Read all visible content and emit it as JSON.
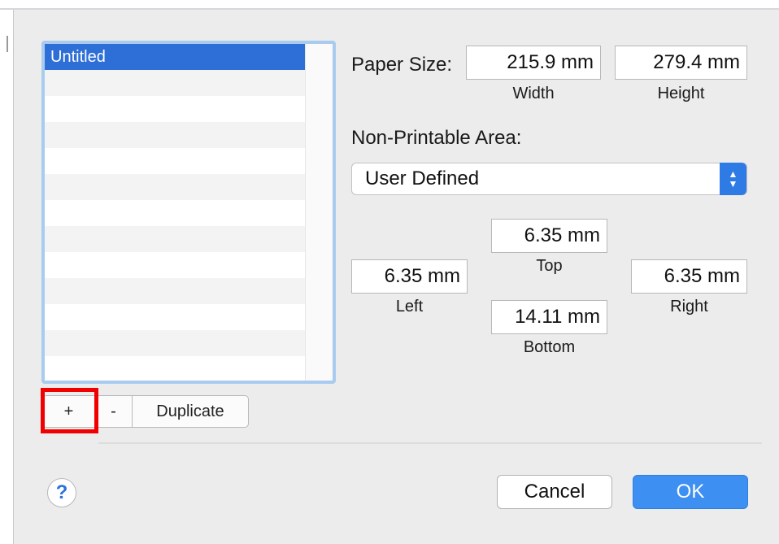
{
  "paper_list": {
    "items": [
      "Untitled"
    ],
    "selected_index": 0,
    "empty_rows": 12
  },
  "list_buttons": {
    "add": "+",
    "remove": "-",
    "duplicate": "Duplicate"
  },
  "paper_size": {
    "label": "Paper Size:",
    "width_value": "215.9 mm",
    "width_label": "Width",
    "height_value": "279.4 mm",
    "height_label": "Height"
  },
  "non_printable": {
    "label": "Non-Printable Area:",
    "popup_value": "User Defined",
    "top_value": "6.35 mm",
    "top_label": "Top",
    "left_value": "6.35 mm",
    "left_label": "Left",
    "right_value": "6.35 mm",
    "right_label": "Right",
    "bottom_value": "14.11 mm",
    "bottom_label": "Bottom"
  },
  "footer": {
    "help": "?",
    "cancel": "Cancel",
    "ok": "OK"
  },
  "colors": {
    "selection": "#2d6fd6",
    "accent": "#3d8ff2",
    "highlight": "#f00000"
  }
}
